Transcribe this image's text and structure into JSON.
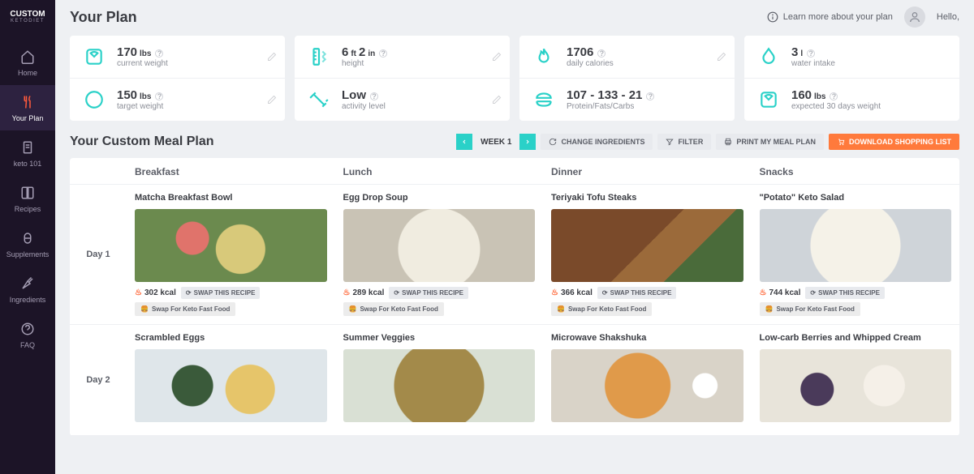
{
  "logo": {
    "main": "CUSTOM",
    "sub": "KETODIET"
  },
  "nav": [
    {
      "label": "Home"
    },
    {
      "label": "Your Plan"
    },
    {
      "label": "keto 101"
    },
    {
      "label": "Recipes"
    },
    {
      "label": "Supplements"
    },
    {
      "label": "Ingredients"
    },
    {
      "label": "FAQ"
    }
  ],
  "header": {
    "title": "Your Plan",
    "learn_more": "Learn more about your plan",
    "greeting": "Hello,"
  },
  "stats": {
    "current_weight": {
      "value": "170",
      "unit": "lbs",
      "label": "current weight"
    },
    "target_weight": {
      "value": "150",
      "unit": "lbs",
      "label": "target weight"
    },
    "height": {
      "value": "6",
      "unit1": "ft",
      "value2": "2",
      "unit2": "in",
      "label": "height"
    },
    "activity": {
      "value": "Low",
      "label": "activity level"
    },
    "calories": {
      "value": "1706",
      "label": "daily calories"
    },
    "macros": {
      "value": "107 - 133 - 21",
      "label": "Protein/Fats/Carbs"
    },
    "water": {
      "value": "3",
      "unit": "l",
      "label": "water intake"
    },
    "expected": {
      "value": "160",
      "unit": "lbs",
      "label": "expected 30 days weight"
    }
  },
  "meal_plan": {
    "title": "Your Custom Meal Plan",
    "week_label": "WEEK 1",
    "buttons": {
      "change_ingredients": "CHANGE INGREDIENTS",
      "filter": "FILTER",
      "print": "PRINT MY MEAL PLAN",
      "download": "DOWNLOAD SHOPPING LIST"
    },
    "columns": [
      "Breakfast",
      "Lunch",
      "Dinner",
      "Snacks"
    ],
    "swap_label": "SWAP THIS RECIPE",
    "fastfood_label": "Swap For Keto Fast Food",
    "days": [
      {
        "label": "Day 1",
        "meals": [
          {
            "title": "Matcha Breakfast Bowl",
            "kcal": "302 kcal"
          },
          {
            "title": "Egg Drop Soup",
            "kcal": "289 kcal"
          },
          {
            "title": "Teriyaki Tofu Steaks",
            "kcal": "366 kcal"
          },
          {
            "title": "\"Potato\" Keto Salad",
            "kcal": "744 kcal"
          }
        ]
      },
      {
        "label": "Day 2",
        "meals": [
          {
            "title": "Scrambled Eggs"
          },
          {
            "title": "Summer Veggies"
          },
          {
            "title": "Microwave Shakshuka"
          },
          {
            "title": "Low-carb Berries and Whipped Cream"
          }
        ]
      }
    ]
  }
}
